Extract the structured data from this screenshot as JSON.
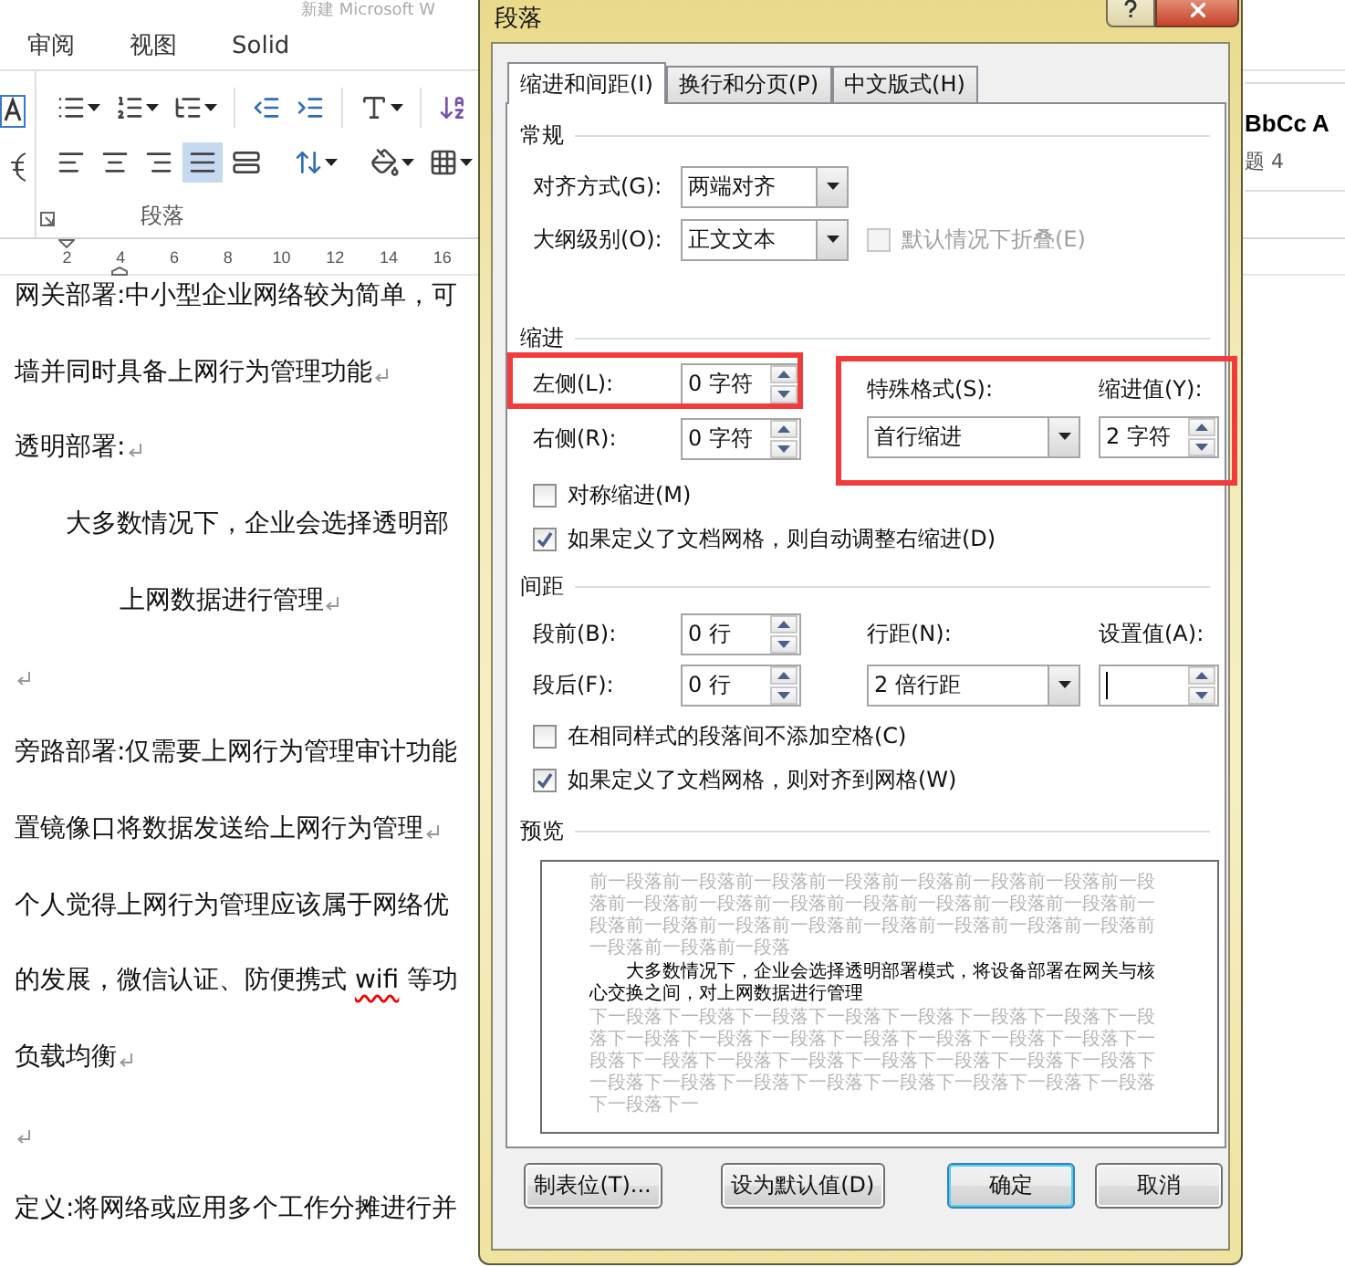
{
  "app": {
    "title": "新建 Microsoft W",
    "tabs": [
      {
        "label": "审阅"
      },
      {
        "label": "视图"
      },
      {
        "label": "Solid"
      }
    ]
  },
  "ribbon": {
    "group_label": "段落",
    "alignment": [
      {
        "kind": "left",
        "selected": false
      },
      {
        "kind": "center",
        "selected": false
      },
      {
        "kind": "right",
        "selected": false
      },
      {
        "kind": "justify",
        "selected": true
      },
      {
        "kind": "distributed",
        "selected": false
      }
    ],
    "styles": {
      "preview": "BbCc",
      "extra": "A",
      "name": "题 4"
    }
  },
  "ruler": {
    "ticks": [
      "2",
      "4",
      "6",
      "8",
      "10",
      "12",
      "14",
      "16"
    ]
  },
  "document": {
    "lines": [
      {
        "kind": "plain",
        "text": "网关部署:中小型企业网络较为简单，可",
        "mark": false
      },
      {
        "kind": "plain",
        "text": "墙并同时具备上网行为管理功能",
        "mark": true
      },
      {
        "kind": "plain",
        "text": "透明部署:",
        "mark": true
      },
      {
        "kind": "indent",
        "text": "大多数情况下，企业会选择透明部",
        "mark": false
      },
      {
        "kind": "deep",
        "text": "上网数据进行管理",
        "mark": true
      },
      {
        "kind": "plain",
        "mark": true
      },
      {
        "kind": "plain",
        "text": "旁路部署:仅需要上网行为管理审计功能",
        "mark": false
      },
      {
        "kind": "plain",
        "text": "置镜像口将数据发送给上网行为管理",
        "mark": true
      },
      {
        "kind": "plain",
        "text": "个人觉得上网行为管理应该属于网络优",
        "mark": false
      },
      {
        "kind": "plain",
        "segments": [
          {
            "text": "的发展，微信认证、防便携式 ",
            "misspelled": false
          },
          {
            "text": "wifi",
            "misspelled": true
          },
          {
            "text": " 等功",
            "misspelled": false
          }
        ],
        "mark": false
      },
      {
        "kind": "plain",
        "text": "负载均衡",
        "mark": true
      },
      {
        "kind": "plain",
        "mark": true
      },
      {
        "kind": "plain",
        "text": "定义:将网络或应用多个工作分摊进行并",
        "mark": false
      }
    ]
  },
  "dialog": {
    "title": "段落",
    "tabs": [
      {
        "label": "缩进和间距(I)",
        "selected": true
      },
      {
        "label": "换行和分页(P)",
        "selected": false
      },
      {
        "label": "中文版式(H)",
        "selected": false
      }
    ],
    "general": {
      "heading": "常规",
      "alignment": {
        "label": "对齐方式(G):",
        "value": "两端对齐"
      },
      "outline": {
        "label": "大纲级别(O):",
        "value": "正文文本"
      },
      "collapse": {
        "label": "默认情况下折叠(E)",
        "checked": false,
        "disabled": true
      }
    },
    "indent": {
      "heading": "缩进",
      "left": {
        "label": "左侧(L):",
        "value": "0 字符",
        "highlighted": true
      },
      "right": {
        "label": "右侧(R):",
        "value": "0 字符",
        "highlighted": false
      },
      "special": {
        "label": "特殊格式(S):",
        "value": "首行缩进",
        "by_label": "缩进值(Y):",
        "by_value": "2 字符",
        "highlighted": true
      },
      "options": [
        {
          "label": "对称缩进(M)",
          "checked": false
        },
        {
          "label": "如果定义了文档网格，则自动调整右缩进(D)",
          "checked": true
        }
      ]
    },
    "spacing": {
      "heading": "间距",
      "before": {
        "label": "段前(B):",
        "value": "0 行"
      },
      "after": {
        "label": "段后(F):",
        "value": "0 行"
      },
      "line": {
        "label": "行距(N):",
        "value": "2 倍行距"
      },
      "at": {
        "label": "设置值(A):",
        "focused": true
      },
      "options": [
        {
          "label": "在相同样式的段落间不添加空格(C)",
          "checked": false
        },
        {
          "label": "如果定义了文档网格，则对齐到网格(W)",
          "checked": true
        }
      ]
    },
    "preview": {
      "heading": "预览",
      "before": "前一段落前一段落前一段落前一段落前一段落前一段落前一段落前一段落前一段落前一段落前一段落前一段落前一段落前一段落前一段落前一段落前一段落前一段落前一段落前一段落前一段落前一段落前一段落前一段落前一段落前一段落",
      "text": "大多数情况下，企业会选择透明部署模式，将设备部署在网关与核心交换之间，对上网数据进行管理",
      "after": "下一段落下一段落下一段落下一段落下一段落下一段落下一段落下一段落下一段落下一段落下一段落下一段落下一段落下一段落下一段落下一段落下一段落下一段落下一段落下一段落下一段落下一段落下一段落下一段落下一段落下一段落下一段落下一段落下一段落下一段落下一段落下一段落下一"
    },
    "buttons": [
      {
        "label": "制表位(T)...",
        "default": false
      },
      {
        "label": "设为默认值(D)",
        "default": false
      },
      {
        "label": "确定",
        "default": true
      },
      {
        "label": "取消",
        "default": false
      }
    ]
  }
}
